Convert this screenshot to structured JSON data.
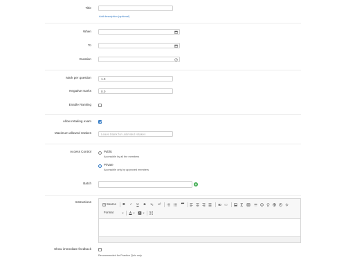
{
  "form": {
    "title": {
      "label": "Title",
      "value": ""
    },
    "add_description": "Add description (optional)",
    "when": {
      "label": "When",
      "value": ""
    },
    "to": {
      "label": "To",
      "value": ""
    },
    "duration": {
      "label": "Duration",
      "value": ""
    },
    "mark_per_question": {
      "label": "Mark per question",
      "value": "1.0"
    },
    "negative_marks": {
      "label": "Negative marks",
      "value": "0.0"
    },
    "enable_ranking": {
      "label": "Enable Ranking",
      "checked": false
    },
    "allow_retaking": {
      "label": "Allow retaking exam",
      "checked": true
    },
    "max_retakes": {
      "label": "Maximum allowed retakes",
      "placeholder": "Leave blank for unlimited retakes"
    },
    "access_control": {
      "label": "Access Control",
      "options": [
        {
          "title": "Public",
          "desc": "Accessible by all the members",
          "selected": false
        },
        {
          "title": "Private",
          "desc": "Accessible only by approved members",
          "selected": true
        }
      ]
    },
    "batch": {
      "label": "Batch",
      "value": ""
    },
    "instructions": {
      "label": "Instructions",
      "toolbar": {
        "source": "Source",
        "bold": "B",
        "italic": "I",
        "underline": "U",
        "strike": "S",
        "subscript": "x₂",
        "superscript": "x²",
        "quote": "❝❞",
        "format": "Format"
      }
    },
    "show_feedback": {
      "label": "Show immediate feedback",
      "checked": false,
      "hint": "Recommended for Practice Quiz only"
    }
  },
  "colors": {
    "accent": "#2f78c4",
    "add": "#3aa94c",
    "border": "#cfcfcf"
  },
  "icons": [
    "calendar-icon",
    "calendar-icon",
    "clock-icon",
    "plus-circle-icon"
  ]
}
